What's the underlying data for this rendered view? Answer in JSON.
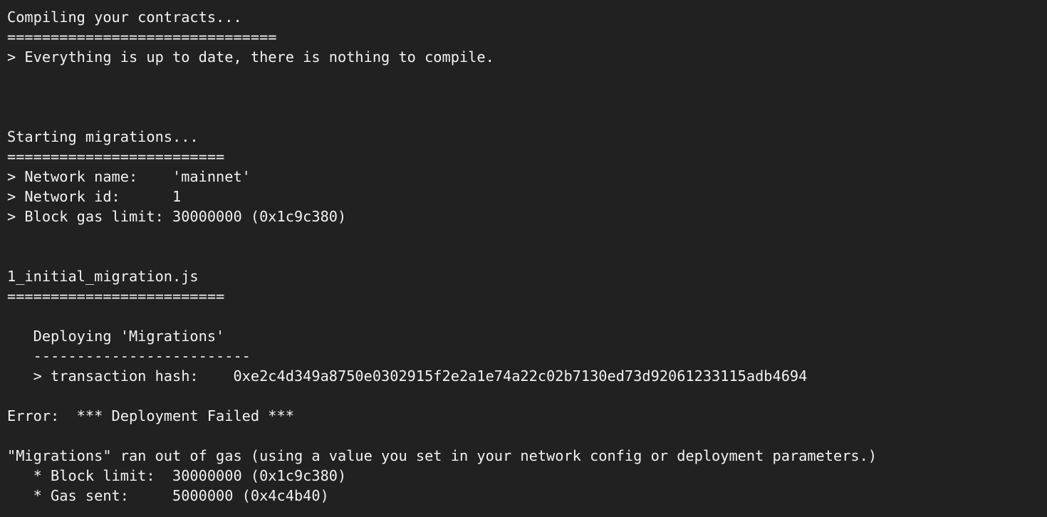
{
  "terminal": {
    "background_color": "#212121",
    "text_color": "#f2f2f2",
    "lines": [
      {
        "id": "compiling-header",
        "text": "Compiling your contracts..."
      },
      {
        "id": "compiling-rule",
        "text": "==============================="
      },
      {
        "id": "compiling-status",
        "text": "> Everything is up to date, there is nothing to compile."
      },
      {
        "id": "blank-1",
        "text": ""
      },
      {
        "id": "blank-2",
        "text": ""
      },
      {
        "id": "blank-3",
        "text": ""
      },
      {
        "id": "migrations-header",
        "text": "Starting migrations..."
      },
      {
        "id": "migrations-rule",
        "text": "========================="
      },
      {
        "id": "network-name",
        "text": "> Network name:    'mainnet'"
      },
      {
        "id": "network-id",
        "text": "> Network id:      1"
      },
      {
        "id": "block-gas-limit",
        "text": "> Block gas limit: 30000000 (0x1c9c380)"
      },
      {
        "id": "blank-4",
        "text": ""
      },
      {
        "id": "blank-5",
        "text": ""
      },
      {
        "id": "migration-file",
        "text": "1_initial_migration.js"
      },
      {
        "id": "migration-file-rule",
        "text": "========================="
      },
      {
        "id": "blank-6",
        "text": ""
      },
      {
        "id": "deploying-contract",
        "text": "   Deploying 'Migrations'"
      },
      {
        "id": "deploying-rule",
        "text": "   -------------------------"
      },
      {
        "id": "transaction-hash",
        "text": "   > transaction hash:    0xe2c4d349a8750e0302915f2e2a1e74a22c02b7130ed73d92061233115adb4694"
      },
      {
        "id": "blank-7",
        "text": ""
      },
      {
        "id": "error-deployment-failed",
        "text": "Error:  *** Deployment Failed ***"
      },
      {
        "id": "blank-8",
        "text": ""
      },
      {
        "id": "error-out-of-gas",
        "text": "\"Migrations\" ran out of gas (using a value you set in your network config or deployment parameters.)"
      },
      {
        "id": "error-block-limit",
        "text": "   * Block limit:  30000000 (0x1c9c380)"
      },
      {
        "id": "error-gas-sent",
        "text": "   * Gas sent:     5000000 (0x4c4b40)"
      }
    ]
  }
}
